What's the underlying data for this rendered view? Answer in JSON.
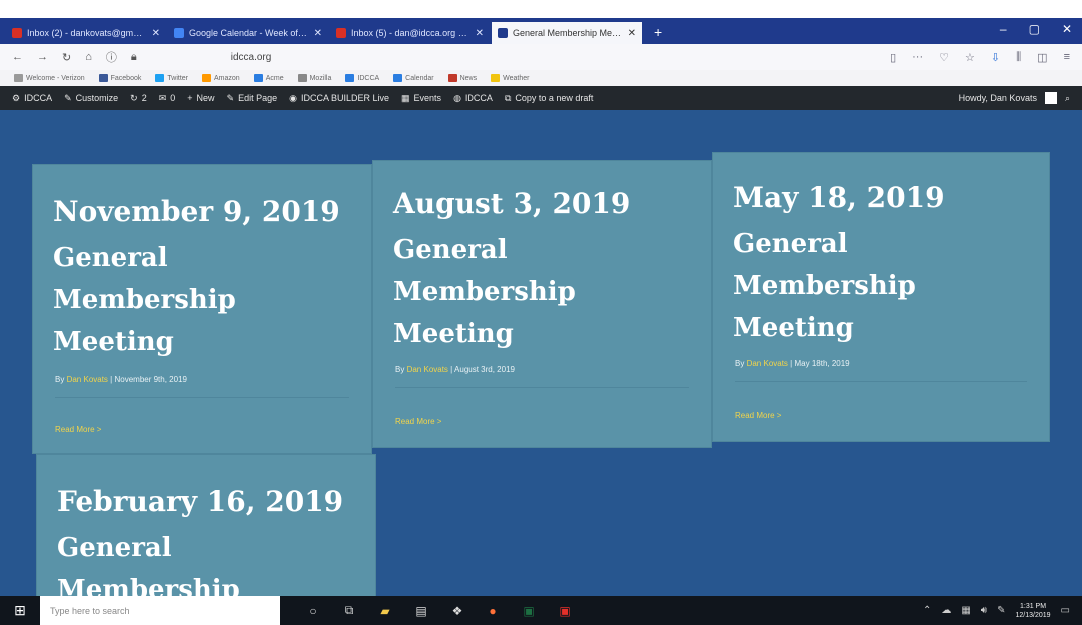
{
  "browser": {
    "tabs": [
      {
        "label": "Inbox (2) - dankovats@gmai...",
        "color": "#d93025"
      },
      {
        "label": "Google Calendar - Week of ...",
        "color": "#4285f4"
      },
      {
        "label": "Inbox (5) - dan@idcca.org - ...",
        "color": "#d93025"
      },
      {
        "label": "General Membership Meet...",
        "color": "#ffffff",
        "active": true
      }
    ],
    "new_tab": "+",
    "window_controls": [
      "–",
      "▢",
      "✕"
    ],
    "url": "idcca.org",
    "bookmarks": [
      "Welcome - Verizon",
      "Facebook",
      "Twitter",
      "Amazon",
      "Acme",
      "Mozilla",
      "IDCCA",
      "Calendar",
      "News",
      "Weather"
    ]
  },
  "admin_bar": {
    "items": [
      {
        "icon": "⚙",
        "label": "IDCCA"
      },
      {
        "icon": "✎",
        "label": "Customize"
      },
      {
        "icon": "↻",
        "label": "2"
      },
      {
        "icon": "✉",
        "label": "0"
      },
      {
        "icon": "+",
        "label": "New"
      },
      {
        "icon": "✎",
        "label": "Edit Page"
      },
      {
        "icon": "◉",
        "label": "IDCCA BUILDER Live"
      },
      {
        "icon": "▦",
        "label": "Events"
      },
      {
        "icon": "◍",
        "label": "IDCCA"
      },
      {
        "icon": "⧉",
        "label": "Copy to a new draft"
      }
    ],
    "greeting": "Howdy, Dan Kovats"
  },
  "posts": [
    {
      "date": "November 9, 2019",
      "title": "General Membership Meeting",
      "by": "By",
      "author": "Dan Kovats",
      "separator": "|",
      "meta_date": "November 9th, 2019",
      "read_more": "Read More >"
    },
    {
      "date": "August 3, 2019",
      "title": "General Membership Meeting",
      "by": "By",
      "author": "Dan Kovats",
      "separator": "|",
      "meta_date": "August 3rd, 2019",
      "read_more": "Read More >"
    },
    {
      "date": "May 18, 2019",
      "title": "General Membership Meeting",
      "by": "By",
      "author": "Dan Kovats",
      "separator": "|",
      "meta_date": "May 18th, 2019",
      "read_more": "Read More >"
    },
    {
      "date": "February 16, 2019",
      "title": "General Membership"
    }
  ],
  "taskbar": {
    "search_placeholder": "Type here to search",
    "time": "1:31 PM",
    "date": "12/13/2019"
  }
}
